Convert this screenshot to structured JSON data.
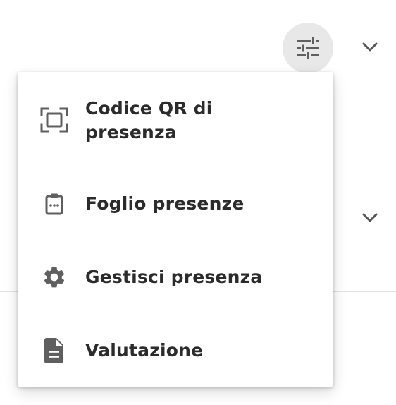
{
  "background": {
    "settings_icon": "tune-sliders-icon",
    "expand_icon": "chevron-down-icon"
  },
  "menu": {
    "items": [
      {
        "label": "Codice QR di presenza",
        "icon": "qr-scan-frame-icon"
      },
      {
        "label": "Foglio presenze",
        "icon": "clipboard-icon"
      },
      {
        "label": "Gestisci presenza",
        "icon": "gear-icon"
      },
      {
        "label": "Valutazione",
        "icon": "document-icon"
      }
    ]
  },
  "colors": {
    "text": "#2b2b2b",
    "icon": "#5f5f5f",
    "button_bg": "#e8e8e8",
    "divider": "#e2e2e2"
  }
}
